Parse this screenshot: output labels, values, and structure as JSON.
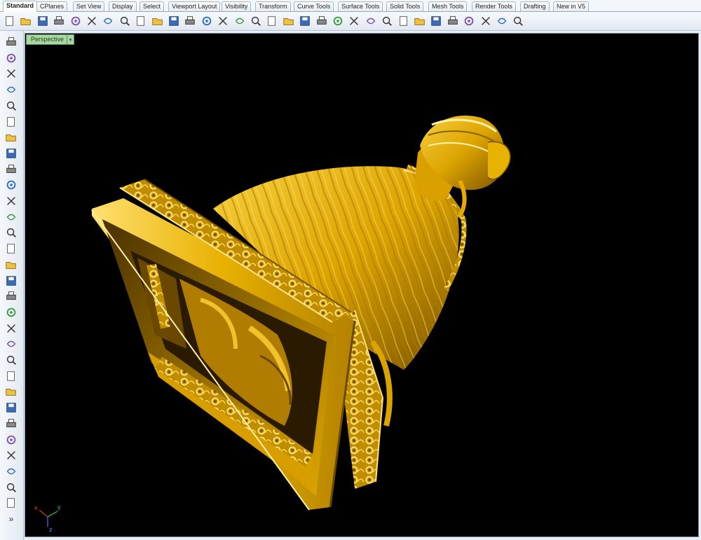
{
  "tabs": [
    "Standard",
    "CPlanes",
    "Set View",
    "Display",
    "Select",
    "Viewport Layout",
    "Visibility",
    "Transform",
    "Curve Tools",
    "Surface Tools",
    "Solid Tools",
    "Mesh Tools",
    "Render Tools",
    "Drafting",
    "New in V5"
  ],
  "active_tab": "Standard",
  "viewport": {
    "label": "Perspective",
    "dropdown_glyph": "▾"
  },
  "axes": {
    "x": "x",
    "y": "y",
    "z": "z"
  },
  "toolbar_icons": [
    "new-icon",
    "open-icon",
    "save-icon",
    "print-icon",
    "import-icon",
    "cut-icon",
    "copy-icon",
    "paste-icon",
    "undo-icon",
    "pan-icon",
    "rotate-view-icon",
    "zoom-icon",
    "zoom-window-icon",
    "zoom-extents-icon",
    "zoom-selected-icon",
    "undo-view-icon",
    "four-viewports-icon",
    "car-icon",
    "hide-icon",
    "show-icon",
    "layer-icon",
    "light-icon",
    "lock-icon",
    "material-icon",
    "color-wheel-icon",
    "render-sphere-icon",
    "render-sphere-2-icon",
    "render-sphere-3-icon",
    "cursor-icon",
    "gear-icon",
    "grid-icon",
    "help-icon"
  ],
  "sidebar_icons": [
    "select-icon",
    "point-icon",
    "polyline-icon",
    "curve-icon",
    "circle-icon",
    "ellipse-icon",
    "polygon-icon",
    "rectangle-icon",
    "arc-icon",
    "fillet-icon",
    "transform-icon",
    "surface-icon",
    "box-icon",
    "sphere-icon",
    "cylinder-icon",
    "extrude-icon",
    "patch-icon",
    "explode-icon",
    "trim-icon",
    "split-icon",
    "boolean-icon",
    "array-icon",
    "offset-icon",
    "blend-icon",
    "text-icon",
    "dimension-icon",
    "group-icon",
    "block-icon",
    "analysis-icon",
    "render-icon",
    "more-icon"
  ],
  "more_glyph": "»",
  "colors": {
    "gold": "#e0a800",
    "viewport_bg": "#000000",
    "accent_green": "#a8d8a2"
  }
}
